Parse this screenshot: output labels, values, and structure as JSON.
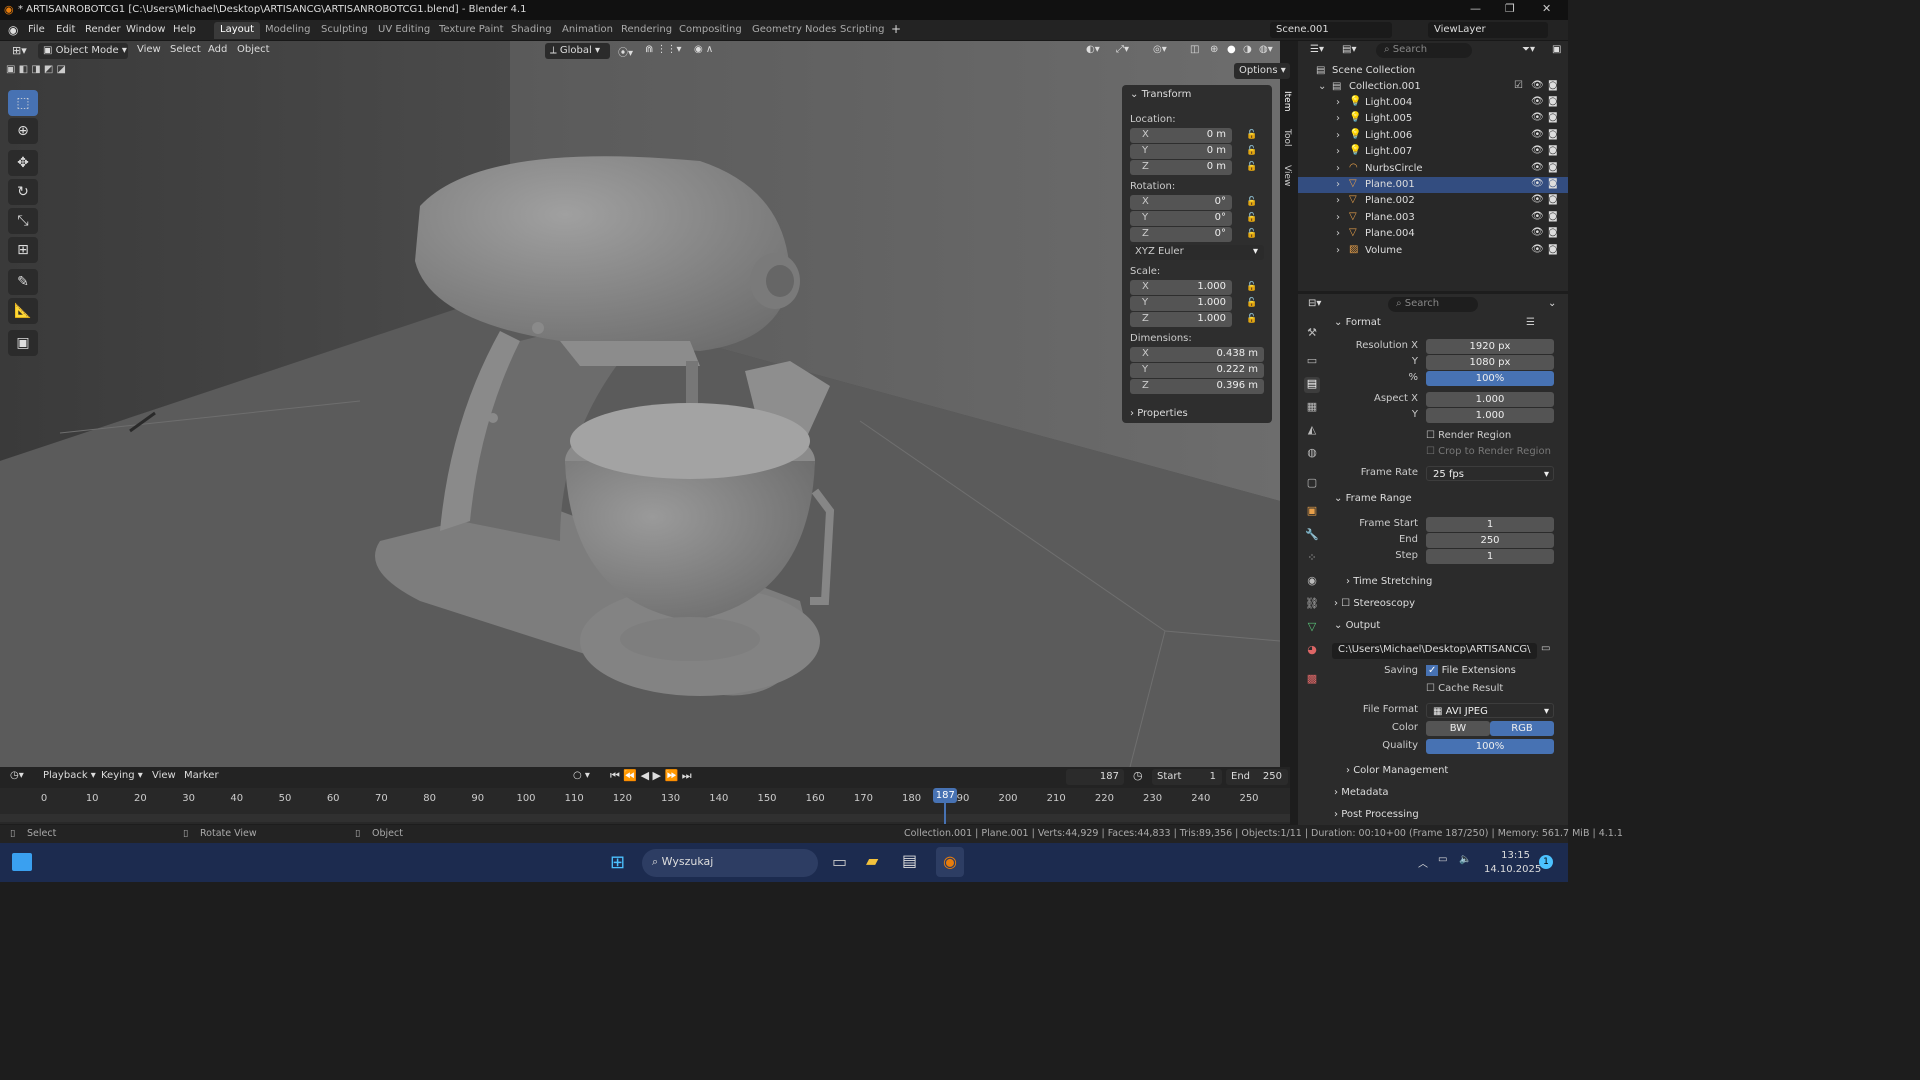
{
  "window": {
    "title": "* ARTISANROBOTCG1 [C:\\Users\\Michael\\Desktop\\ARTISANCG\\ARTISANROBOTCG1.blend] - Blender 4.1"
  },
  "menu": [
    "File",
    "Edit",
    "Render",
    "Window",
    "Help"
  ],
  "workspaces": [
    "Layout",
    "Modeling",
    "Sculpting",
    "UV Editing",
    "Texture Paint",
    "Shading",
    "Animation",
    "Rendering",
    "Compositing",
    "Geometry Nodes",
    "Scripting"
  ],
  "scene": "Scene.001",
  "view_layer": "ViewLayer",
  "viewport_header": {
    "mode": "Object Mode",
    "menus": [
      "View",
      "Select",
      "Add",
      "Object"
    ],
    "orientation": "Global",
    "options": "Options"
  },
  "npanel": {
    "title": "Transform",
    "location_label": "Location:",
    "location": [
      "0 m",
      "0 m",
      "0 m"
    ],
    "rotation_label": "Rotation:",
    "rotation": [
      "0°",
      "0°",
      "0°"
    ],
    "rotation_mode": "XYZ Euler",
    "scale_label": "Scale:",
    "scale": [
      "1.000",
      "1.000",
      "1.000"
    ],
    "dimensions_label": "Dimensions:",
    "dimensions": [
      "0.438 m",
      "0.222 m",
      "0.396 m"
    ],
    "axes": [
      "X",
      "Y",
      "Z"
    ],
    "properties": "Properties",
    "tabs": [
      "Item",
      "Tool",
      "View"
    ]
  },
  "outliner": {
    "search": "Search",
    "scene_collection": "Scene Collection",
    "collection": "Collection.001",
    "items": [
      {
        "name": "Light.004",
        "icon": "light-icon",
        "selected": false
      },
      {
        "name": "Light.005",
        "icon": "light-icon",
        "selected": false
      },
      {
        "name": "Light.006",
        "icon": "light-icon",
        "selected": false
      },
      {
        "name": "Light.007",
        "icon": "light-icon",
        "selected": false
      },
      {
        "name": "NurbsCircle",
        "icon": "curve-icon",
        "selected": false
      },
      {
        "name": "Plane.001",
        "icon": "mesh-icon",
        "selected": true
      },
      {
        "name": "Plane.002",
        "icon": "mesh-icon",
        "selected": false
      },
      {
        "name": "Plane.003",
        "icon": "mesh-icon",
        "selected": false
      },
      {
        "name": "Plane.004",
        "icon": "mesh-icon",
        "selected": false
      },
      {
        "name": "Volume",
        "icon": "volume-icon",
        "selected": false
      }
    ]
  },
  "properties": {
    "search": "Search",
    "format": {
      "title": "Format",
      "resolution_x_label": "Resolution X",
      "resolution_x": "1920 px",
      "y_label": "Y",
      "resolution_y": "1080 px",
      "pct_label": "%",
      "percent": "100%",
      "aspect_x_label": "Aspect X",
      "aspect_x": "1.000",
      "aspect_y_label": "Y",
      "aspect_y": "1.000",
      "render_region": "Render Region",
      "crop": "Crop to Render Region",
      "frame_rate_label": "Frame Rate",
      "frame_rate": "25 fps"
    },
    "frame_range": {
      "title": "Frame Range",
      "start_label": "Frame Start",
      "start": "1",
      "end_label": "End",
      "end": "250",
      "step_label": "Step",
      "step": "1",
      "time_stretching": "Time Stretching"
    },
    "stereoscopy": "Stereoscopy",
    "output": {
      "title": "Output",
      "path": "C:\\Users\\Michael\\Desktop\\ARTISANCG\\",
      "saving_label": "Saving",
      "file_extensions": "File Extensions",
      "cache_result": "Cache Result",
      "file_format_label": "File Format",
      "file_format": "AVI JPEG",
      "color_label": "Color",
      "color_bw": "BW",
      "color_rgb": "RGB",
      "quality_label": "Quality",
      "quality": "100%",
      "color_management": "Color Management"
    },
    "metadata": "Metadata",
    "post_processing": "Post Processing"
  },
  "timeline": {
    "menus": [
      "Playback",
      "Keying",
      "View",
      "Marker"
    ],
    "current_frame": "187",
    "start_label": "Start",
    "start": "1",
    "end_label": "End",
    "end": "250",
    "ticks": [
      "0",
      "10",
      "20",
      "30",
      "40",
      "50",
      "60",
      "70",
      "80",
      "90",
      "100",
      "110",
      "120",
      "130",
      "140",
      "150",
      "160",
      "170",
      "180",
      "190",
      "200",
      "210",
      "220",
      "230",
      "240",
      "250"
    ],
    "playhead": "187"
  },
  "statusbar": {
    "select": "Select",
    "rotate": "Rotate View",
    "object": "Object",
    "info": "Collection.001 | Plane.001 | Verts:44,929 | Faces:44,833 | Tris:89,356 | Objects:1/11 | Duration: 00:10+00 (Frame 187/250) | Memory: 561.7 MiB | 4.1.1"
  },
  "taskbar": {
    "search": "Wyszukaj",
    "time": "13:15",
    "date": "14.10.2025",
    "notifications": "1"
  }
}
